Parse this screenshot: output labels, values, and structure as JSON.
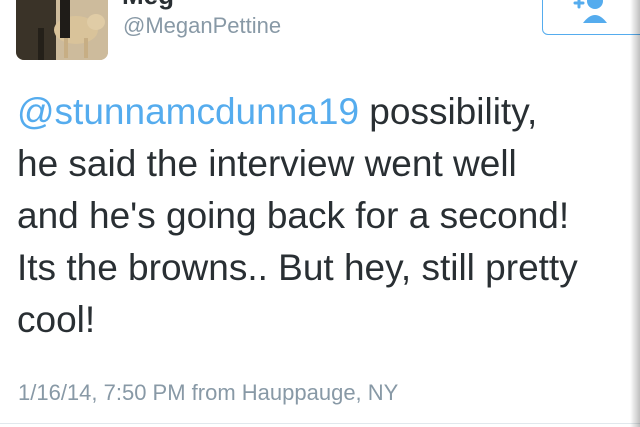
{
  "header": {
    "display_name": "Meg",
    "handle": "@MeganPettine",
    "follow_icon": "follow-user-icon",
    "accent_color": "#55acee"
  },
  "tweet": {
    "mention": "@stunnamcdunna19",
    "line1_rest": " possibility,",
    "line2": "he said the interview went well",
    "line3": "and he's going back for a second!",
    "line4": "Its the browns.. But hey, still pretty",
    "line5": "cool!",
    "meta": "1/16/14, 7:50 PM from Hauppauge, NY"
  }
}
